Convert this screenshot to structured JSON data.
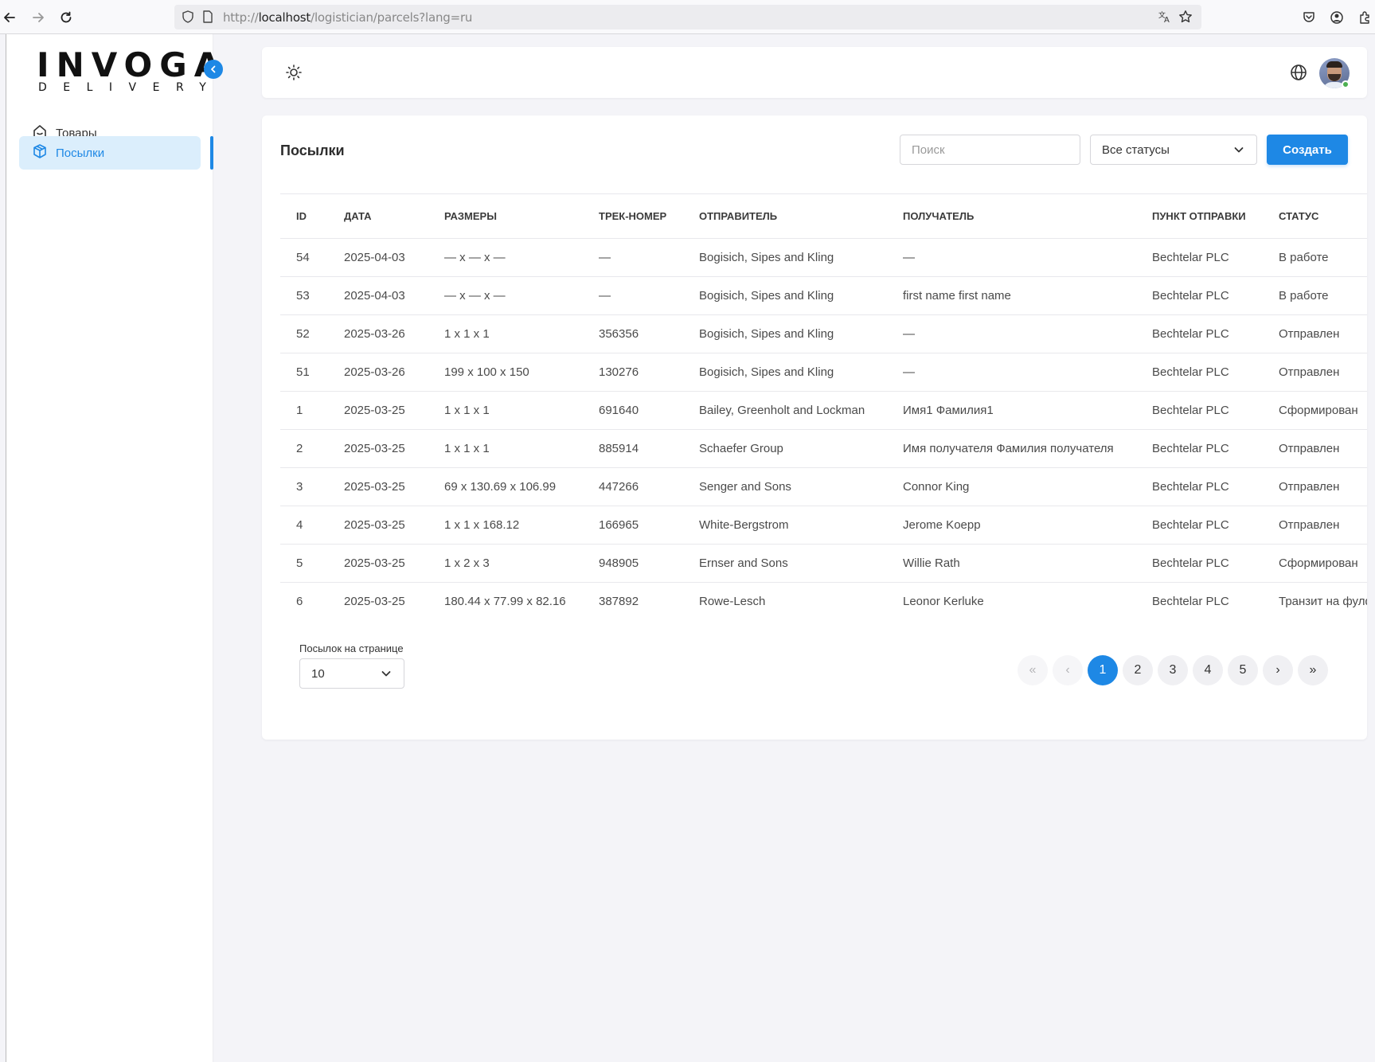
{
  "browser": {
    "url_prefix": "http://",
    "url_host": "localhost",
    "url_path": "/logistician/parcels?lang=ru"
  },
  "brand": {
    "name": "INVOGA",
    "tagline": "DELIVERY"
  },
  "sidebar": {
    "items": [
      {
        "label": "Товары",
        "icon": "home-icon",
        "active": false
      },
      {
        "label": "Посылки",
        "icon": "box-icon",
        "active": true
      }
    ]
  },
  "page": {
    "title": "Посылки",
    "search_placeholder": "Поиск",
    "status_filter": "Все статусы",
    "create_label": "Создать"
  },
  "table": {
    "columns": [
      "ID",
      "ДАТА",
      "РАЗМЕРЫ",
      "ТРЕК-НОМЕР",
      "ОТПРАВИТЕЛЬ",
      "ПОЛУЧАТЕЛЬ",
      "ПУНКТ ОТПРАВКИ",
      "СТАТУС"
    ],
    "rows": [
      [
        "54",
        "2025-04-03",
        "— x — x —",
        "—",
        "Bogisich, Sipes and Kling",
        "—",
        "Bechtelar PLC",
        "В работе"
      ],
      [
        "53",
        "2025-04-03",
        "— x — x —",
        "—",
        "Bogisich, Sipes and Kling",
        "first name first name",
        "Bechtelar PLC",
        "В работе"
      ],
      [
        "52",
        "2025-03-26",
        "1 x 1 x 1",
        "356356",
        "Bogisich, Sipes and Kling",
        "—",
        "Bechtelar PLC",
        "Отправлен"
      ],
      [
        "51",
        "2025-03-26",
        "199 x 100 x 150",
        "130276",
        "Bogisich, Sipes and Kling",
        "—",
        "Bechtelar PLC",
        "Отправлен"
      ],
      [
        "1",
        "2025-03-25",
        "1 x 1 x 1",
        "691640",
        "Bailey, Greenholt and Lockman",
        "Имя1 Фамилия1",
        "Bechtelar PLC",
        "Сформирован"
      ],
      [
        "2",
        "2025-03-25",
        "1 x 1 x 1",
        "885914",
        "Schaefer Group",
        "Имя получателя Фамилия получателя",
        "Bechtelar PLC",
        "Отправлен"
      ],
      [
        "3",
        "2025-03-25",
        "69 x 130.69 x 106.99",
        "447266",
        "Senger and Sons",
        "Connor King",
        "Bechtelar PLC",
        "Отправлен"
      ],
      [
        "4",
        "2025-03-25",
        "1 x 1 x 168.12",
        "166965",
        "White-Bergstrom",
        "Jerome Koepp",
        "Bechtelar PLC",
        "Отправлен"
      ],
      [
        "5",
        "2025-03-25",
        "1 x 2 x 3",
        "948905",
        "Ernser and Sons",
        "Willie Rath",
        "Bechtelar PLC",
        "Сформирован"
      ],
      [
        "6",
        "2025-03-25",
        "180.44 x 77.99 x 82.16",
        "387892",
        "Rowe-Lesch",
        "Leonor Kerluke",
        "Bechtelar PLC",
        "Транзит на фулфилмент"
      ]
    ]
  },
  "pagination": {
    "per_page_label": "Посылок на странице",
    "per_page_value": "10",
    "first": "«",
    "prev": "‹",
    "pages": [
      "1",
      "2",
      "3",
      "4",
      "5"
    ],
    "current": "1",
    "next": "›",
    "last": "»"
  },
  "colors": {
    "accent": "#1e88e5",
    "active_bg": "#dbeefc",
    "online": "#4caf50"
  }
}
